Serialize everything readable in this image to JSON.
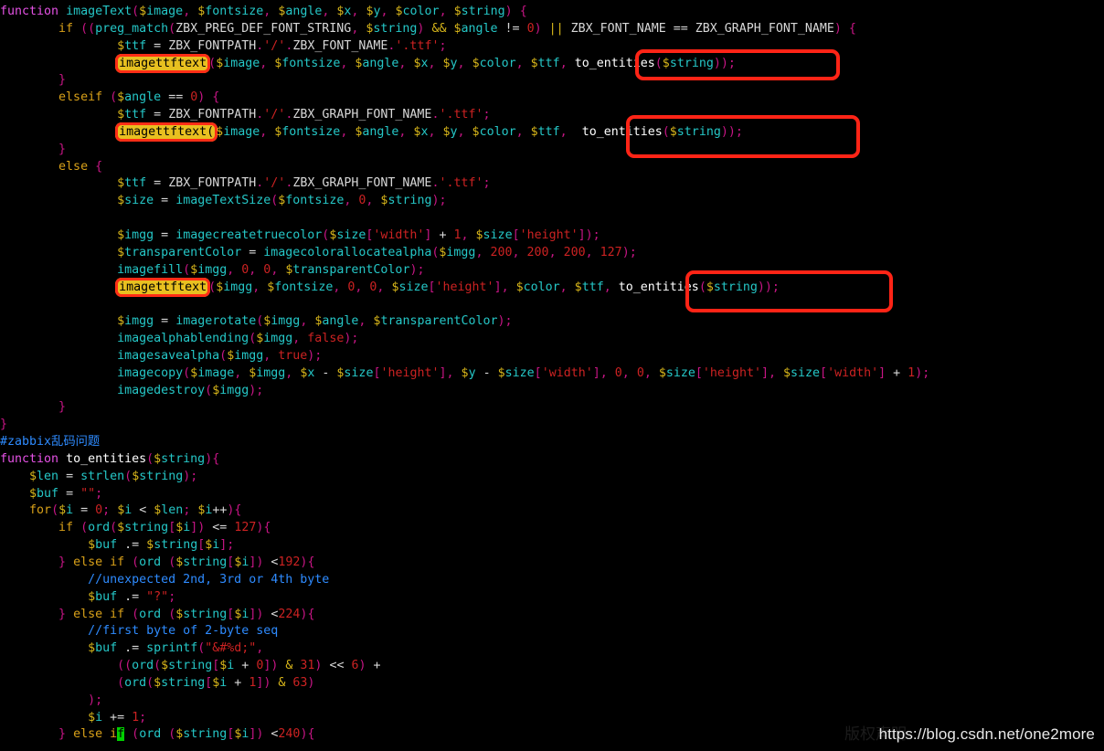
{
  "window": {
    "background_color": "#000000",
    "foreground_color": "#d0d0d0",
    "language": "php"
  },
  "watermark": {
    "url": "https://blog.csdn.net/one2more",
    "ghost_text": "版权声明"
  },
  "highlight": {
    "fill_color": "#e8c020",
    "border_color": "#ff2416",
    "text_color": "#000000",
    "terms": [
      "imagettftext",
      "imagettftext(",
      "imagettftext"
    ],
    "boxed_terms": [
      "to_entities($string));",
      "to_entities($string));",
      "to_entities($string));"
    ]
  },
  "cursor": {
    "color": "#00d000",
    "character": "f",
    "line": 43
  },
  "code": {
    "language_label": "php",
    "lines": [
      "function imageText($image, $fontsize, $angle, $x, $y, $color, $string) {",
      "        if ((preg_match(ZBX_PREG_DEF_FONT_STRING, $string) && $angle != 0) || ZBX_FONT_NAME == ZBX_GRAPH_FONT_NAME) {",
      "                $ttf = ZBX_FONTPATH.'/'.ZBX_FONT_NAME.'.ttf';",
      "                imagettftext($image, $fontsize, $angle, $x, $y, $color, $ttf, to_entities($string));",
      "        }",
      "        elseif ($angle == 0) {",
      "                $ttf = ZBX_FONTPATH.'/'.ZBX_GRAPH_FONT_NAME.'.ttf';",
      "                imagettftext($image, $fontsize, $angle, $x, $y, $color, $ttf, to_entities($string));",
      "        }",
      "        else {",
      "                $ttf = ZBX_FONTPATH.'/'.ZBX_GRAPH_FONT_NAME.'.ttf';",
      "                $size = imageTextSize($fontsize, 0, $string);",
      "",
      "                $imgg = imagecreatetruecolor($size['width'] + 1, $size['height']);",
      "                $transparentColor = imagecolorallocatealpha($imgg, 200, 200, 200, 127);",
      "                imagefill($imgg, 0, 0, $transparentColor);",
      "                imagettftext($imgg, $fontsize, 0, 0, $size['height'], $color, $ttf, to_entities($string));",
      "",
      "                $imgg = imagerotate($imgg, $angle, $transparentColor);",
      "                imagealphablending($imgg, false);",
      "                imagesavealpha($imgg, true);",
      "                imagecopy($image, $imgg, $x - $size['height'], $y - $size['width'], 0, 0, $size['height'], $size['width'] + 1);",
      "                imagedestroy($imgg);",
      "        }",
      "}",
      "#zabbix乱码问题",
      "function to_entities($string){",
      "    $len = strlen($string);",
      "    $buf = \"\";",
      "    for($i = 0; $i < $len; $i++){",
      "        if (ord($string[$i]) <= 127){",
      "            $buf .= $string[$i];",
      "        } else if (ord ($string[$i]) <192){",
      "            //unexpected 2nd, 3rd or 4th byte",
      "            $buf .= \"?\";",
      "        } else if (ord ($string[$i]) <224){",
      "            //first byte of 2-byte seq",
      "            $buf .= sprintf(\"&#%d;\",",
      "                ((ord($string[$i + 0]) & 31) << 6) +",
      "                (ord($string[$i + 1]) & 63)",
      "            );",
      "            $i += 1;",
      "        } else if (ord ($string[$i]) <240){"
    ]
  }
}
